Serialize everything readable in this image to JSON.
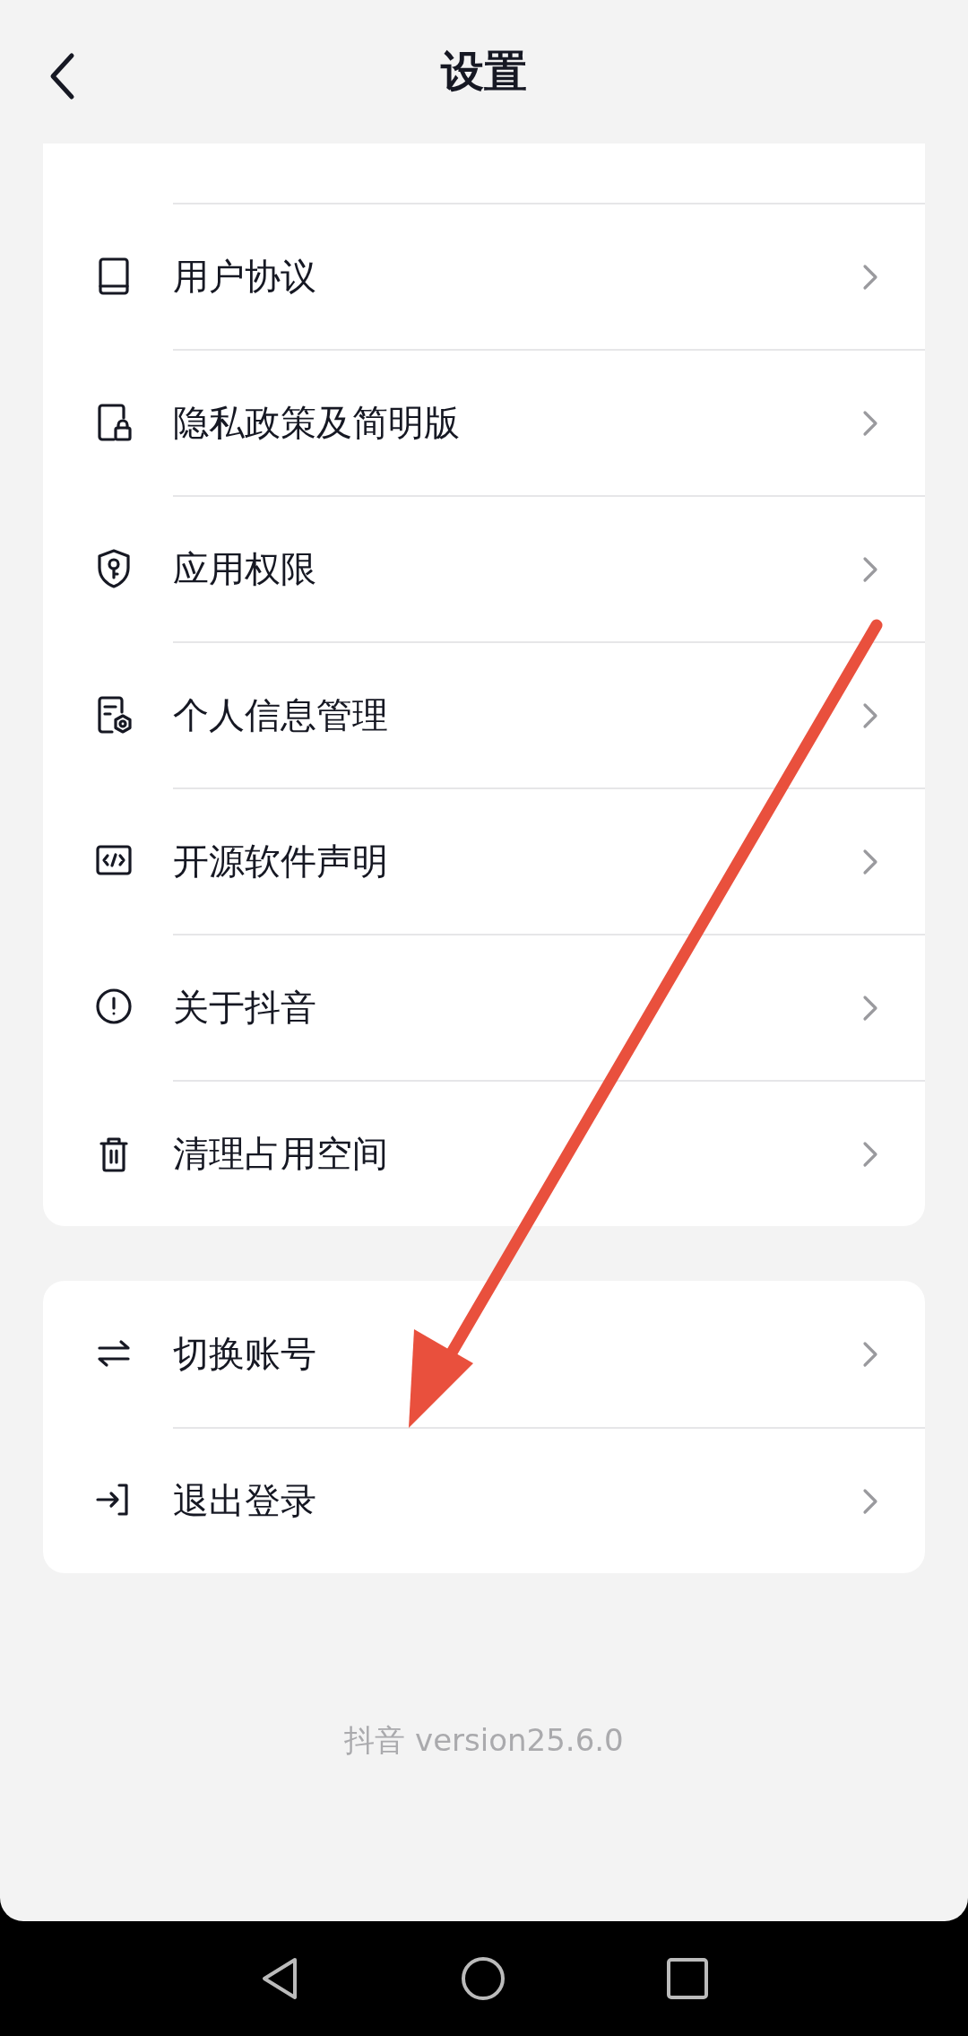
{
  "header": {
    "title": "设置"
  },
  "groups": [
    {
      "items": [
        {
          "label": "用户协议"
        },
        {
          "label": "隐私政策及简明版"
        },
        {
          "label": "应用权限"
        },
        {
          "label": "个人信息管理"
        },
        {
          "label": "开源软件声明"
        },
        {
          "label": "关于抖音"
        },
        {
          "label": "清理占用空间"
        }
      ]
    },
    {
      "items": [
        {
          "label": "切换账号"
        },
        {
          "label": "退出登录"
        }
      ]
    }
  ],
  "footer": {
    "version": "抖音 version25.6.0"
  }
}
